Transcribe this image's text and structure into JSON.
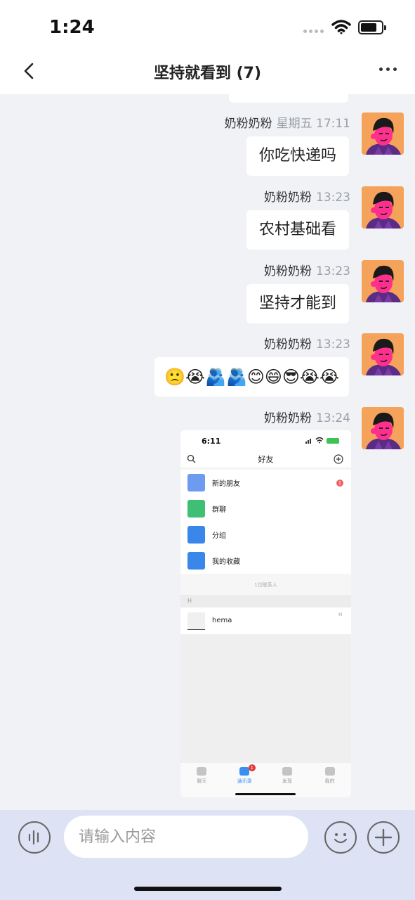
{
  "status_bar": {
    "time": "1:24"
  },
  "header": {
    "title": "坚持就看到 (7)"
  },
  "messages": [
    {
      "sender": "奶粉奶粉",
      "time": "星期五 17:11",
      "text": "你吃快递吗"
    },
    {
      "sender": "奶粉奶粉",
      "time": "13:23",
      "text": "农村基础看"
    },
    {
      "sender": "奶粉奶粉",
      "time": "13:23",
      "text": "坚持才能到"
    },
    {
      "sender": "奶粉奶粉",
      "time": "13:23",
      "text": "🙁😭🫂🫂😊😄😎😭😭"
    },
    {
      "sender": "奶粉奶粉",
      "time": "13:24"
    }
  ],
  "image_message": {
    "status_time": "6:11",
    "title": "好友",
    "rows": [
      "新的朋友",
      "群聊",
      "分组",
      "我的收藏"
    ],
    "new_friends_badge": "1",
    "contact_count": "1位联系人",
    "section": "H",
    "contact_name": "hema",
    "contact_index": "H",
    "tabs": [
      "聊天",
      "通讯录",
      "发现",
      "我的"
    ],
    "tab_badge": "1"
  },
  "input": {
    "placeholder": "请输入内容"
  }
}
